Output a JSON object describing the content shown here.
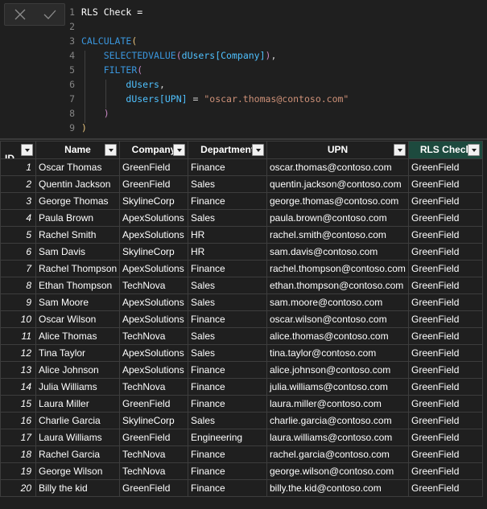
{
  "formula_bar": {
    "cancel_icon": "close-icon",
    "commit_icon": "check-icon",
    "lines": [
      {
        "n": "1",
        "tokens": [
          {
            "t": "RLS Check = ",
            "c": "t-default"
          }
        ]
      },
      {
        "n": "2",
        "tokens": []
      },
      {
        "n": "3",
        "tokens": [
          {
            "t": "CALCULATE",
            "c": "t-fn"
          },
          {
            "t": "(",
            "c": "t-paren1"
          }
        ]
      },
      {
        "n": "4",
        "tokens": [
          {
            "t": "    ",
            "c": "t-default"
          },
          {
            "t": "SELECTEDVALUE",
            "c": "t-fn"
          },
          {
            "t": "(",
            "c": "t-paren2"
          },
          {
            "t": "dUsers[Company]",
            "c": "t-ref"
          },
          {
            "t": ")",
            "c": "t-paren2"
          },
          {
            "t": ",",
            "c": "t-punc"
          }
        ]
      },
      {
        "n": "5",
        "tokens": [
          {
            "t": "    ",
            "c": "t-default"
          },
          {
            "t": "FILTER",
            "c": "t-fn"
          },
          {
            "t": "(",
            "c": "t-paren2"
          }
        ]
      },
      {
        "n": "6",
        "tokens": [
          {
            "t": "        ",
            "c": "t-default"
          },
          {
            "t": "dUsers",
            "c": "t-ref"
          },
          {
            "t": ",",
            "c": "t-punc"
          }
        ]
      },
      {
        "n": "7",
        "tokens": [
          {
            "t": "        ",
            "c": "t-default"
          },
          {
            "t": "dUsers[UPN]",
            "c": "t-ref"
          },
          {
            "t": " = ",
            "c": "t-punc"
          },
          {
            "t": "\"oscar.thomas@contoso.com\"",
            "c": "t-str"
          }
        ]
      },
      {
        "n": "8",
        "tokens": [
          {
            "t": "    ",
            "c": "t-default"
          },
          {
            "t": ")",
            "c": "t-paren2"
          }
        ]
      },
      {
        "n": "9",
        "tokens": [
          {
            "t": ")",
            "c": "t-paren1"
          }
        ]
      }
    ]
  },
  "table": {
    "columns": [
      {
        "label": "ID",
        "key": "id"
      },
      {
        "label": "Name",
        "key": "name"
      },
      {
        "label": "Company",
        "key": "company"
      },
      {
        "label": "Department",
        "key": "department"
      },
      {
        "label": "UPN",
        "key": "upn"
      },
      {
        "label": "RLS Check",
        "key": "rls"
      }
    ],
    "rows": [
      [
        "1",
        "Oscar Thomas",
        "GreenField",
        "Finance",
        "oscar.thomas@contoso.com",
        "GreenField"
      ],
      [
        "2",
        "Quentin Jackson",
        "GreenField",
        "Sales",
        "quentin.jackson@contoso.com",
        "GreenField"
      ],
      [
        "3",
        "George Thomas",
        "SkylineCorp",
        "Finance",
        "george.thomas@contoso.com",
        "GreenField"
      ],
      [
        "4",
        "Paula Brown",
        "ApexSolutions",
        "Sales",
        "paula.brown@contoso.com",
        "GreenField"
      ],
      [
        "5",
        "Rachel Smith",
        "ApexSolutions",
        "HR",
        "rachel.smith@contoso.com",
        "GreenField"
      ],
      [
        "6",
        "Sam Davis",
        "SkylineCorp",
        "HR",
        "sam.davis@contoso.com",
        "GreenField"
      ],
      [
        "7",
        "Rachel Thompson",
        "ApexSolutions",
        "Finance",
        "rachel.thompson@contoso.com",
        "GreenField"
      ],
      [
        "8",
        "Ethan Thompson",
        "TechNova",
        "Sales",
        "ethan.thompson@contoso.com",
        "GreenField"
      ],
      [
        "9",
        "Sam Moore",
        "ApexSolutions",
        "Sales",
        "sam.moore@contoso.com",
        "GreenField"
      ],
      [
        "10",
        "Oscar Wilson",
        "ApexSolutions",
        "Finance",
        "oscar.wilson@contoso.com",
        "GreenField"
      ],
      [
        "11",
        "Alice Thomas",
        "TechNova",
        "Sales",
        "alice.thomas@contoso.com",
        "GreenField"
      ],
      [
        "12",
        "Tina Taylor",
        "ApexSolutions",
        "Sales",
        "tina.taylor@contoso.com",
        "GreenField"
      ],
      [
        "13",
        "Alice Johnson",
        "ApexSolutions",
        "Finance",
        "alice.johnson@contoso.com",
        "GreenField"
      ],
      [
        "14",
        "Julia Williams",
        "TechNova",
        "Finance",
        "julia.williams@contoso.com",
        "GreenField"
      ],
      [
        "15",
        "Laura Miller",
        "GreenField",
        "Finance",
        "laura.miller@contoso.com",
        "GreenField"
      ],
      [
        "16",
        "Charlie Garcia",
        "SkylineCorp",
        "Sales",
        "charlie.garcia@contoso.com",
        "GreenField"
      ],
      [
        "17",
        "Laura Williams",
        "GreenField",
        "Engineering",
        "laura.williams@contoso.com",
        "GreenField"
      ],
      [
        "18",
        "Rachel Garcia",
        "TechNova",
        "Finance",
        "rachel.garcia@contoso.com",
        "GreenField"
      ],
      [
        "19",
        "George Wilson",
        "TechNova",
        "Finance",
        "george.wilson@contoso.com",
        "GreenField"
      ],
      [
        "20",
        "Billy the kid",
        "GreenField",
        "Finance",
        "billy.the.kid@contoso.com",
        "GreenField"
      ]
    ]
  },
  "colors": {
    "background": "#1f1f1f",
    "selected_column_header": "#1d4a3e",
    "dax_function": "#3a96dd",
    "dax_reference": "#4fc1ff",
    "dax_string": "#ce9178"
  }
}
